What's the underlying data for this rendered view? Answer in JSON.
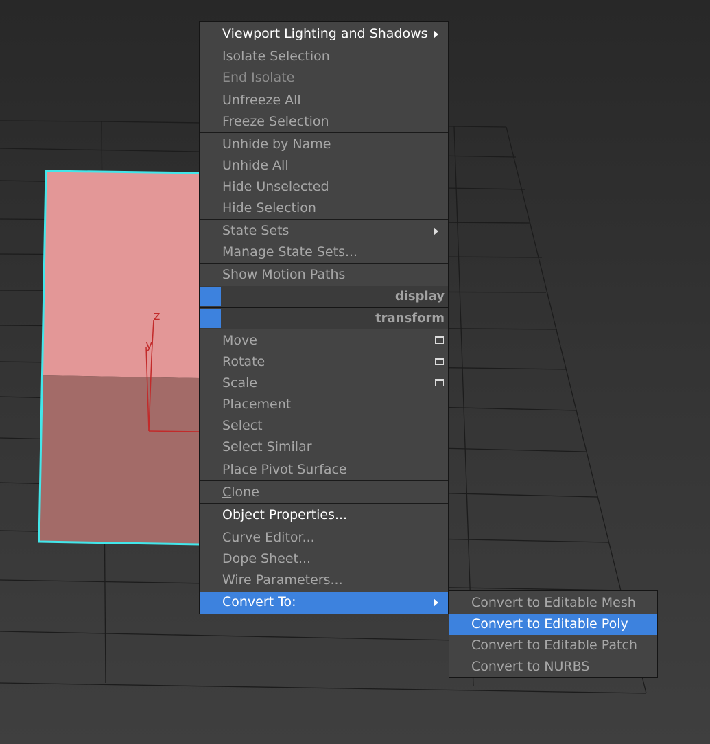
{
  "viewport": {
    "axis_z": "z",
    "axis_y": "y",
    "plane_color": "#e39797",
    "selection_color": "#43e6ea"
  },
  "quad_menu": {
    "items": [
      {
        "label": "Viewport Lighting and Shadows",
        "submenu": true
      },
      {
        "label": "Isolate Selection"
      },
      {
        "label": "End Isolate",
        "disabled": true
      },
      {
        "label": "Unfreeze All"
      },
      {
        "label": "Freeze Selection"
      },
      {
        "label": "Unhide by Name"
      },
      {
        "label": "Unhide All"
      },
      {
        "label": "Hide Unselected"
      },
      {
        "label": "Hide Selection"
      },
      {
        "label": "State Sets",
        "submenu": true
      },
      {
        "label": "Manage State Sets..."
      },
      {
        "label": "Show Motion Paths"
      }
    ],
    "headers": [
      {
        "label": "display",
        "color": "#3d82de"
      },
      {
        "label": "transform",
        "color": "#3d82de"
      }
    ],
    "transform_items": [
      {
        "label": "Move",
        "settings_icon": "settings-box-icon"
      },
      {
        "label": "Rotate",
        "settings_icon": "settings-box-icon"
      },
      {
        "label": "Scale",
        "settings_icon": "settings-box-icon"
      },
      {
        "label": "Placement"
      },
      {
        "label": "Select"
      },
      {
        "label": "Select Similar",
        "underline_char": "S"
      },
      {
        "label": "Place Pivot Surface"
      },
      {
        "label": "Clone",
        "underline_char": "C"
      },
      {
        "label": "Object Properties...",
        "underline_char": "P",
        "emphasis": true
      },
      {
        "label": "Curve Editor..."
      },
      {
        "label": "Dope Sheet..."
      },
      {
        "label": "Wire Parameters..."
      },
      {
        "label": "Convert To:",
        "submenu": true,
        "highlighted": true
      }
    ],
    "select_similar_parts": [
      "Select ",
      "S",
      "imilar"
    ],
    "clone_parts": [
      "",
      "C",
      "lone"
    ],
    "object_properties_parts": [
      "Object ",
      "P",
      "roperties..."
    ]
  },
  "convert_submenu": {
    "items": [
      {
        "label": "Convert to Editable Mesh"
      },
      {
        "label": "Convert to Editable Poly",
        "highlighted": true
      },
      {
        "label": "Convert to Editable Patch"
      },
      {
        "label": "Convert to NURBS"
      }
    ]
  },
  "colors": {
    "highlight": "#3d82de",
    "menu_bg": "#444444"
  }
}
